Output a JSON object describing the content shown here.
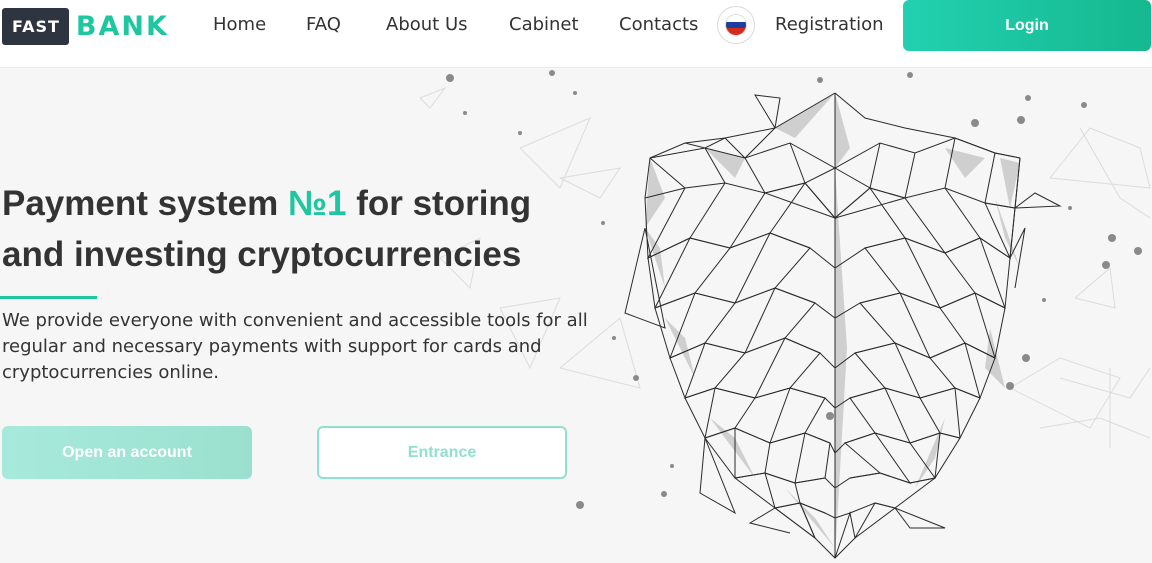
{
  "header": {
    "logo": {
      "part1": "FAST",
      "part2": "BANK"
    },
    "nav": [
      {
        "label": "Home"
      },
      {
        "label": "FAQ"
      },
      {
        "label": "About Us"
      },
      {
        "label": "Cabinet"
      },
      {
        "label": "Contacts"
      }
    ],
    "language_icon": "russia-flag-icon",
    "registration_label": "Registration",
    "login_label": "Login"
  },
  "hero": {
    "title_part1": "Payment system ",
    "title_accent": "№1",
    "title_part2": " for storing and investing cryptocurrencies",
    "description": "We provide everyone with convenient and accessible tools for all regular and necessary payments with support for cards and cryptocurrencies online.",
    "open_account_label": "Open an account",
    "entrance_label": "Entrance"
  },
  "colors": {
    "accent": "#1ec7a0",
    "dark": "#2e3440",
    "text": "#333333"
  }
}
